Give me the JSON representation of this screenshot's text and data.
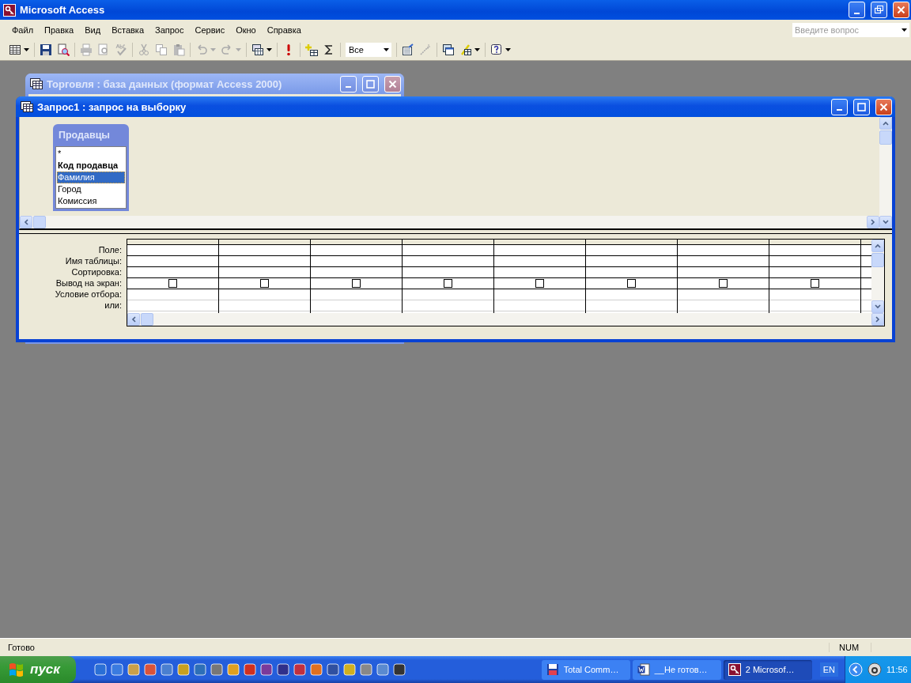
{
  "app_window": {
    "title": "Microsoft Access"
  },
  "menu": [
    {
      "label": "Файл"
    },
    {
      "label": "Правка"
    },
    {
      "label": "Вид"
    },
    {
      "label": "Вставка"
    },
    {
      "label": "Запрос"
    },
    {
      "label": "Сервис"
    },
    {
      "label": "Окно"
    },
    {
      "label": "Справка"
    }
  ],
  "ask_box": {
    "placeholder": "Введите вопрос"
  },
  "toolbar": [
    {
      "kind": "button",
      "disabled": false
    },
    {
      "kind": "button",
      "disabled": false
    },
    {
      "kind": "button",
      "disabled": false
    },
    {
      "kind": "button",
      "disabled": true
    },
    {
      "kind": "button",
      "disabled": true
    },
    {
      "kind": "button",
      "disabled": true
    },
    {
      "kind": "button",
      "disabled": true
    },
    {
      "kind": "button",
      "disabled": true
    },
    {
      "kind": "button",
      "disabled": true
    },
    {
      "kind": "button",
      "disabled": true
    },
    {
      "kind": "button",
      "disabled": true
    },
    {
      "kind": "button",
      "disabled": false
    },
    {
      "kind": "button",
      "disabled": false
    },
    {
      "kind": "button",
      "disabled": false
    },
    {
      "kind": "button",
      "disabled": false
    },
    {
      "kind": "combo",
      "value": "Все"
    },
    {
      "kind": "button",
      "disabled": false
    },
    {
      "kind": "button",
      "disabled": true
    },
    {
      "kind": "button",
      "disabled": false
    },
    {
      "kind": "button",
      "disabled": false
    },
    {
      "kind": "button",
      "disabled": false
    }
  ],
  "db_window": {
    "title": "Торговля : база данных (формат Access 2000)",
    "active": false
  },
  "query_window": {
    "title": "Запрос1 : запрос на выборку",
    "active": true
  },
  "field_list": {
    "title": "Продавцы",
    "fields": [
      {
        "name": "*",
        "primary_key": false,
        "selected": false
      },
      {
        "name": "Код продавца",
        "primary_key": true,
        "selected": false
      },
      {
        "name": "Фамилия",
        "primary_key": false,
        "selected": true
      },
      {
        "name": "Город",
        "primary_key": false,
        "selected": false
      },
      {
        "name": "Комиссия",
        "primary_key": false,
        "selected": false
      }
    ]
  },
  "grid": {
    "row_labels": [
      "Поле:",
      "Имя таблицы:",
      "Сортировка:",
      "Вывод на экран:",
      "Условие отбора:",
      "или:"
    ],
    "columns": [
      {
        "show": false
      },
      {
        "show": false
      },
      {
        "show": false
      },
      {
        "show": false
      },
      {
        "show": false
      },
      {
        "show": false
      },
      {
        "show": false
      },
      {
        "show": false
      }
    ]
  },
  "status_bar": {
    "message": "Готово",
    "indicator": "NUM"
  },
  "taskbar": {
    "start": "пуск",
    "tasks": [
      {
        "kind": "floppy",
        "label": "Total Comm…",
        "selected": false
      },
      {
        "kind": "word",
        "label": "__Не готов…",
        "selected": false
      },
      {
        "kind": "access",
        "label": "2 Microsof…",
        "selected": true
      }
    ],
    "language": "EN",
    "clock": "11:56"
  }
}
